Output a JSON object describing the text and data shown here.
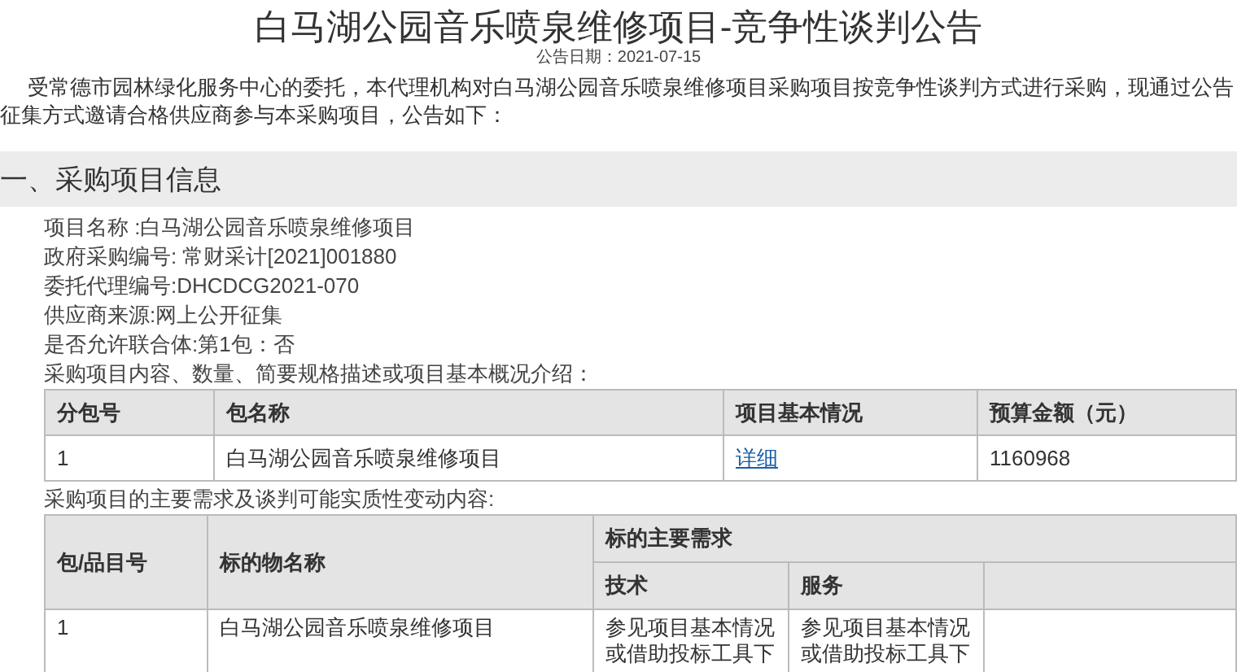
{
  "title": "白马湖公园音乐喷泉维修项目-竞争性谈判公告",
  "date": "公告日期：2021-07-15",
  "intro": "受常德市园林绿化服务中心的委托，本代理机构对白马湖公园音乐喷泉维修项目采购项目按竞争性谈判方式进行采购，现通过公告征集方式邀请合格供应商参与本采购项目，公告如下：",
  "section": {
    "heading": "一、采购项目信息",
    "fields": [
      "项目名称 :白马湖公园音乐喷泉维修项目",
      "政府采购编号: 常财采计[2021]001880",
      "委托代理编号:DHCDCG2021-070",
      "供应商来源:网上公开征集",
      "是否允许联合体:第1包：否"
    ],
    "packages_caption": "采购项目内容、数量、简要规格描述或项目基本概况介绍：",
    "packages_table": {
      "columns": [
        "分包号",
        "包名称",
        "项目基本情况",
        "预算金额（元）"
      ],
      "rows": [
        {
          "package": "1",
          "name": "白马湖公园音乐喷泉维修项目",
          "details_link": "详细",
          "budget": "1160968"
        }
      ]
    },
    "requirements_caption": "采购项目的主要需求及谈判可能实质性变动内容:",
    "requirements_table": {
      "columns": [
        "包/品目号",
        "标的物名称"
      ],
      "group_heading": "标的主要需求",
      "subcolumns": [
        "技术",
        "服务"
      ],
      "rows": [
        {
          "package": "1",
          "name": "白马湖公园音乐喷泉维修项目",
          "technical": "参见项目基本情况或借助投标工具下",
          "service": "参见项目基本情况或借助投标工具下"
        }
      ]
    }
  }
}
